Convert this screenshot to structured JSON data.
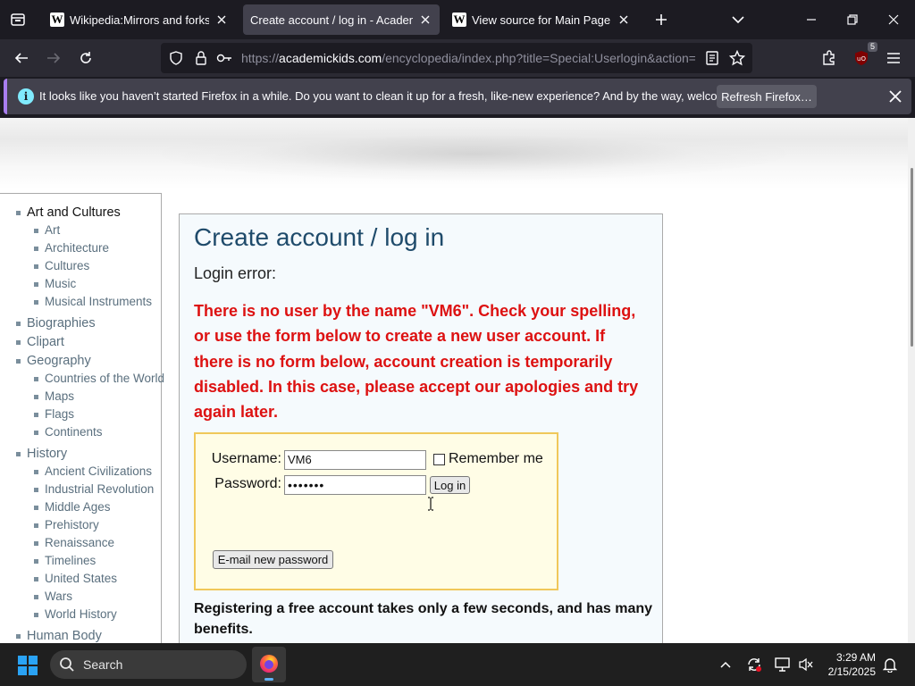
{
  "browser": {
    "tabs": [
      {
        "favicon": "W",
        "title": "Wikipedia:Mirrors and forks/All",
        "active": false
      },
      {
        "favicon": "",
        "title": "Create account / log in - Academic",
        "active": true
      },
      {
        "favicon": "W",
        "title": "View source for Main Page - Wi",
        "active": false
      }
    ],
    "url": {
      "prefix": "https://",
      "domain": "academickids.com",
      "path": "/encyclopedia/index.php?title=Special:Userlogin&action=s"
    },
    "extension_badge": "5"
  },
  "notification": {
    "text": "It looks like you haven’t started Firefox in a while. Do you want to clean it up for a fresh, like-new experience? And by the way, welcome back!",
    "button": "Refresh Firefox…"
  },
  "sidebar": {
    "groups": [
      {
        "category": "Art and Cultures",
        "items": [
          "Art",
          "Architecture",
          "Cultures",
          "Music",
          "Musical Instruments"
        ]
      },
      {
        "category": "Biographies",
        "items": []
      },
      {
        "category": "Clipart",
        "items": []
      },
      {
        "category": "Geography",
        "items": [
          "Countries of the World",
          "Maps",
          "Flags",
          "Continents"
        ]
      },
      {
        "category": "History",
        "items": [
          "Ancient Civilizations",
          "Industrial Revolution",
          "Middle Ages",
          "Prehistory",
          "Renaissance",
          "Timelines",
          "United States",
          "Wars",
          "World History"
        ]
      },
      {
        "category": "Human Body",
        "items": []
      }
    ]
  },
  "main": {
    "title": "Create account / log in",
    "subtitle": "Login error:",
    "error": "There is no user by the name \"VM6\". Check your spelling, or use the form below to create a new user account. If there is no form below, account creation is temporarily disabled. In this case, please accept our apologies and try again later.",
    "form": {
      "username_label": "Username:",
      "username_value": "VM6",
      "password_label": "Password:",
      "password_value": "•••••••",
      "remember_label": "Remember me",
      "login_button": "Log in",
      "email_button": "E-mail new password"
    },
    "register_text": "Registering a free account takes only a few seconds, and has many benefits."
  },
  "taskbar": {
    "search_label": "Search",
    "time": "3:29 AM",
    "date": "2/15/2025"
  },
  "colors": {
    "accent": "#a97ef0",
    "error": "#dd1111",
    "heading": "#1f4b6b",
    "link": "#5a6f7e"
  }
}
